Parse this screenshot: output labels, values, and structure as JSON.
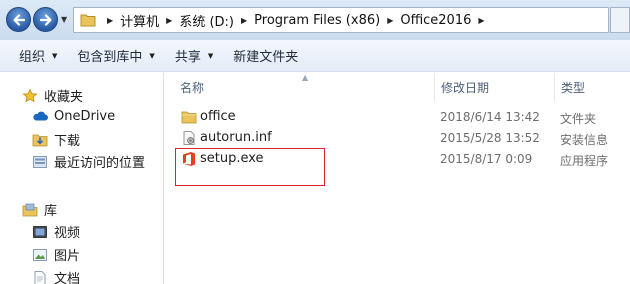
{
  "address": {
    "crumbs": [
      "计算机",
      "系统 (D:)",
      "Program Files (x86)",
      "Office2016"
    ]
  },
  "toolbar": {
    "organize": "组织",
    "include_in_library": "包含到库中",
    "share": "共享",
    "new_folder": "新建文件夹"
  },
  "nav": {
    "favorites": "收藏夹",
    "onedrive": "OneDrive",
    "downloads": "下载",
    "recent": "最近访问的位置",
    "libraries": "库",
    "videos": "视频",
    "pictures": "图片",
    "documents": "文档"
  },
  "list": {
    "columns": {
      "name": "名称",
      "modified": "修改日期",
      "type": "类型"
    },
    "rows": [
      {
        "name": "office",
        "modified": "2018/6/14 13:42",
        "type": "文件夹",
        "icon": "folder-icon"
      },
      {
        "name": "autorun.inf",
        "modified": "2015/5/28 13:52",
        "type": "安装信息",
        "icon": "config-file-icon"
      },
      {
        "name": "setup.exe",
        "modified": "2015/8/17 0:09",
        "type": "应用程序",
        "icon": "office-app-icon"
      }
    ]
  },
  "colors": {
    "highlight_border": "#d9232e",
    "folder_yellow": "#e8c45a",
    "office_orange": "#e3411b"
  }
}
